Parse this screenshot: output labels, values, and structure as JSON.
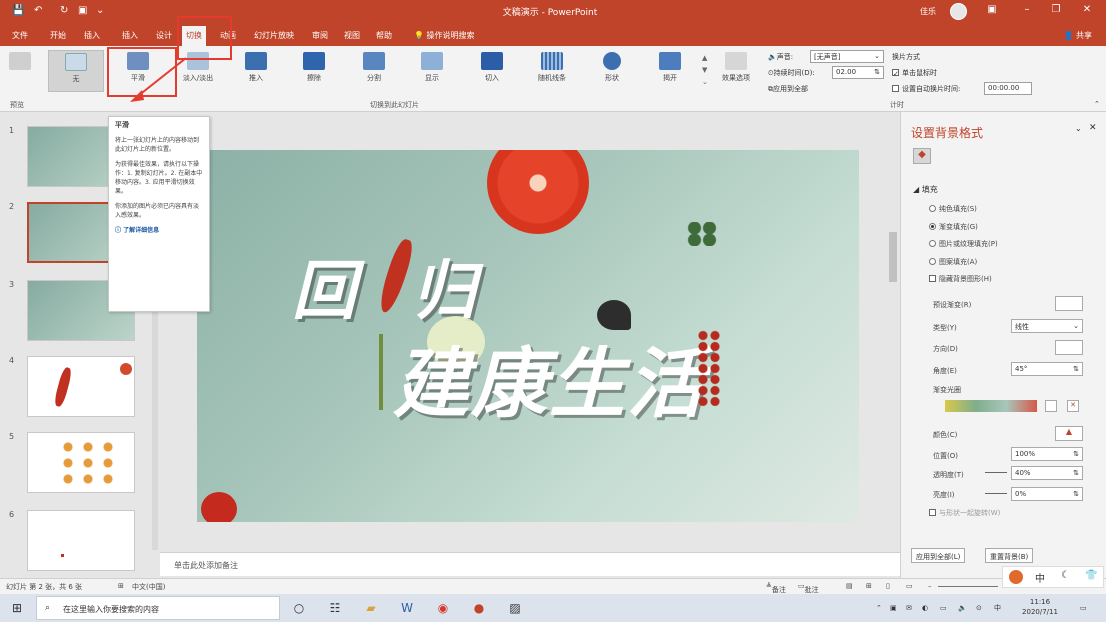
{
  "titlebar": {
    "doc_title": "文稿演示 - PowerPoint",
    "user": "佳乐",
    "min": "–",
    "restore": "❐",
    "close": "✕",
    "ribbon_opts": "▣"
  },
  "tabs": [
    "文件",
    "开始",
    "插入",
    "插入",
    "设计",
    "切换",
    "动画",
    "幻灯片放映",
    "审阅",
    "视图",
    "帮助"
  ],
  "tell_me": "操作说明搜索",
  "share": "共享",
  "ribbon": {
    "preview": "预览",
    "transitions": [
      "无",
      "平滑",
      "淡入/淡出",
      "推入",
      "擦除",
      "分割",
      "显示",
      "切入",
      "随机线条",
      "形状",
      "揭开"
    ],
    "effect_options": "效果选项",
    "group_preview": "预览",
    "group_transitions": "切换到此幻灯片",
    "group_timing": "计时",
    "sound_label": "声音:",
    "sound_value": "[无声音]",
    "duration_label": "持续时间(D):",
    "duration_value": "02.00",
    "apply_all": "应用到全部",
    "advance_label": "换片方式",
    "on_click": "单击鼠标时",
    "after_label": "设置自动换片时间:",
    "after_value": "00:00.00"
  },
  "tooltip": {
    "title": "平滑",
    "p1": "将上一张幻灯片上的内容移动到此幻灯片上的新位置。",
    "p2": "为获得最佳效果，请执行以下操作：1. 复制幻灯片。2. 在副本中移动内容。3. 应用平滑切换效果。",
    "p3": "你添加的图片必须已内容具有淡入感效果。",
    "link": "了解详细信息"
  },
  "slide": {
    "line1a": "回",
    "line1b": "归",
    "line2": "建康生活"
  },
  "thumbs": [
    "1",
    "2",
    "3",
    "4",
    "5",
    "6"
  ],
  "notes_placeholder": "单击此处添加备注",
  "pane": {
    "title": "设置背景格式",
    "section": "填充",
    "options": [
      "纯色填充(S)",
      "渐变填充(G)",
      "图片或纹理填充(P)",
      "图案填充(A)",
      "隐藏背景图形(H)"
    ],
    "preset_label": "预设渐变(R)",
    "type_label": "类型(Y)",
    "type_value": "线性",
    "direction_label": "方向(D)",
    "angle_label": "角度(E)",
    "angle_value": "45°",
    "stops_label": "渐变光圈",
    "color_label": "颜色(C)",
    "position_label": "位置(O)",
    "position_value": "100%",
    "transparency_label": "透明度(T)",
    "transparency_value": "40%",
    "brightness_label": "亮度(I)",
    "brightness_value": "0%",
    "rotate_label": "与形状一起旋转(W)",
    "apply_all_btn": "应用到全部(L)",
    "reset_btn": "重置背景(B)"
  },
  "status": {
    "slide_info": "幻灯片 第 2 张，共 6 张",
    "lang": "中文(中国)",
    "notes": "备注",
    "comments": "批注"
  },
  "taskbar": {
    "search_placeholder": "在这里输入你要搜索的内容",
    "time": "11:16",
    "date": "2020/7/11"
  }
}
